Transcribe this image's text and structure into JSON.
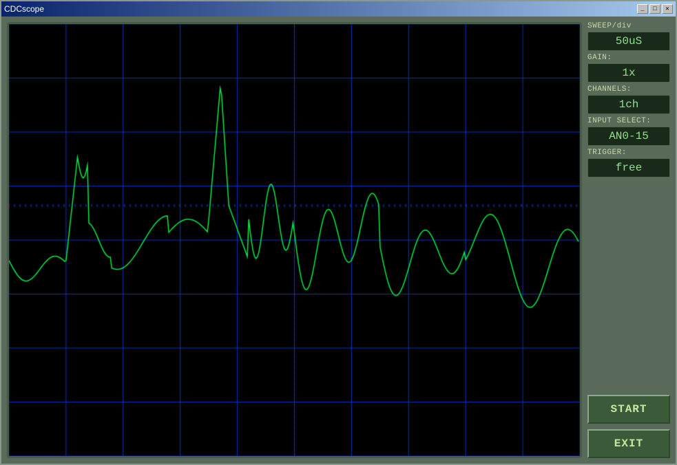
{
  "window": {
    "title": "CDCscope",
    "title_buttons": [
      "_",
      "□",
      "✕"
    ]
  },
  "controls": {
    "sweep_label": "SWEEP/div",
    "sweep_value": "50uS",
    "gain_label": "GAIN:",
    "gain_value": "1x",
    "channels_label": "CHANNELS:",
    "channels_value": "1ch",
    "input_label": "INPUT SELECT:",
    "input_value": "AN0-15",
    "trigger_label": "TRIGGER:",
    "trigger_value": "free",
    "start_label": "START",
    "exit_label": "EXIT"
  },
  "scope": {
    "grid_color": "#0000cc",
    "trace_color": "#00ee44",
    "background": "#000000"
  }
}
